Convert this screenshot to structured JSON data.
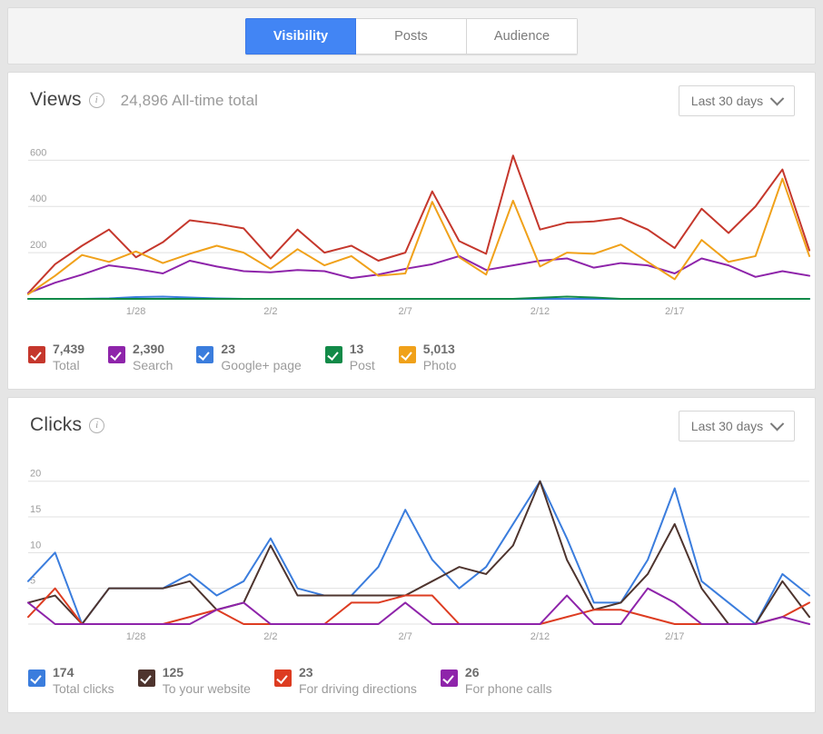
{
  "tabs": [
    {
      "label": "Visibility",
      "active": true
    },
    {
      "label": "Posts",
      "active": false
    },
    {
      "label": "Audience",
      "active": false
    }
  ],
  "views_card": {
    "title": "Views",
    "info_icon": "info-icon",
    "subtitle": "24,896 All-time total",
    "range_label": "Last 30 days",
    "legend": [
      {
        "value": "7,439",
        "label": "Total",
        "color": "#c5372c"
      },
      {
        "value": "2,390",
        "label": "Search",
        "color": "#8e24aa"
      },
      {
        "value": "23",
        "label": "Google+ page",
        "color": "#3b7ddd"
      },
      {
        "value": "13",
        "label": "Post",
        "color": "#128a48"
      },
      {
        "value": "5,013",
        "label": "Photo",
        "color": "#f0a11a"
      }
    ]
  },
  "clicks_card": {
    "title": "Clicks",
    "info_icon": "info-icon",
    "range_label": "Last 30 days",
    "legend": [
      {
        "value": "174",
        "label": "Total clicks",
        "color": "#3b7ddd"
      },
      {
        "value": "125",
        "label": "To your website",
        "color": "#4e342e"
      },
      {
        "value": "23",
        "label": "For driving directions",
        "color": "#dd3c21"
      },
      {
        "value": "26",
        "label": "For phone calls",
        "color": "#8e24aa"
      }
    ]
  },
  "chart_data": [
    {
      "type": "line",
      "id": "views",
      "title": "Views",
      "xlabel": "",
      "ylabel": "",
      "ylim": [
        0,
        680
      ],
      "yticks": [
        200,
        400,
        600
      ],
      "grid": true,
      "legend_position": "bottom",
      "x": [
        "1/24",
        "1/25",
        "1/26",
        "1/27",
        "1/28",
        "1/29",
        "1/30",
        "1/31",
        "2/1",
        "2/2",
        "2/3",
        "2/4",
        "2/5",
        "2/6",
        "2/7",
        "2/8",
        "2/9",
        "2/10",
        "2/11",
        "2/12",
        "2/13",
        "2/14",
        "2/15",
        "2/16",
        "2/17",
        "2/18",
        "2/19",
        "2/20",
        "2/21",
        "2/22"
      ],
      "xticks": [
        "1/28",
        "2/2",
        "2/7",
        "2/12",
        "2/17"
      ],
      "series": [
        {
          "name": "Total",
          "color": "#c5372c",
          "values": [
            25,
            150,
            230,
            300,
            180,
            245,
            340,
            325,
            305,
            175,
            300,
            200,
            230,
            165,
            200,
            465,
            250,
            195,
            620,
            300,
            330,
            335,
            350,
            300,
            220,
            390,
            285,
            400,
            560,
            210
          ]
        },
        {
          "name": "Search",
          "color": "#8e24aa",
          "values": [
            25,
            70,
            105,
            145,
            130,
            110,
            165,
            140,
            120,
            115,
            125,
            120,
            90,
            105,
            130,
            150,
            185,
            125,
            145,
            165,
            175,
            135,
            155,
            145,
            110,
            175,
            145,
            95,
            120,
            100
          ]
        },
        {
          "name": "Google+ page",
          "color": "#3b7ddd",
          "values": [
            0,
            0,
            0,
            2,
            8,
            10,
            6,
            2,
            0,
            0,
            0,
            0,
            0,
            0,
            0,
            0,
            0,
            0,
            0,
            0,
            0,
            0,
            0,
            0,
            0,
            0,
            0,
            0,
            0,
            0
          ]
        },
        {
          "name": "Post",
          "color": "#128a48",
          "values": [
            0,
            0,
            0,
            0,
            0,
            0,
            0,
            0,
            0,
            0,
            0,
            0,
            0,
            0,
            0,
            0,
            0,
            0,
            0,
            5,
            10,
            6,
            0,
            0,
            0,
            0,
            0,
            0,
            0,
            0
          ]
        },
        {
          "name": "Photo",
          "color": "#f0a11a",
          "values": [
            20,
            100,
            190,
            160,
            205,
            155,
            195,
            230,
            200,
            130,
            215,
            145,
            185,
            100,
            110,
            420,
            180,
            105,
            425,
            140,
            200,
            195,
            235,
            160,
            85,
            255,
            160,
            185,
            520,
            185
          ]
        }
      ]
    },
    {
      "type": "line",
      "id": "clicks",
      "title": "Clicks",
      "xlabel": "",
      "ylabel": "",
      "ylim": [
        0,
        22
      ],
      "yticks": [
        5,
        10,
        15,
        20
      ],
      "grid": true,
      "legend_position": "bottom",
      "x": [
        "1/24",
        "1/25",
        "1/26",
        "1/27",
        "1/28",
        "1/29",
        "1/30",
        "1/31",
        "2/1",
        "2/2",
        "2/3",
        "2/4",
        "2/5",
        "2/6",
        "2/7",
        "2/8",
        "2/9",
        "2/10",
        "2/11",
        "2/12",
        "2/13",
        "2/14",
        "2/15",
        "2/16",
        "2/17",
        "2/18",
        "2/19",
        "2/20",
        "2/21",
        "2/22"
      ],
      "xticks": [
        "1/28",
        "2/2",
        "2/7",
        "2/12",
        "2/17"
      ],
      "series": [
        {
          "name": "Total clicks",
          "color": "#3b7ddd",
          "values": [
            6,
            10,
            0,
            5,
            5,
            5,
            7,
            4,
            6,
            12,
            5,
            4,
            4,
            8,
            16,
            9,
            5,
            8,
            14,
            20,
            12,
            3,
            3,
            9,
            19,
            6,
            3,
            0,
            7,
            4
          ]
        },
        {
          "name": "To your website",
          "color": "#4e342e",
          "values": [
            3,
            4,
            0,
            5,
            5,
            5,
            6,
            2,
            3,
            11,
            4,
            4,
            4,
            4,
            4,
            6,
            8,
            7,
            11,
            20,
            9,
            2,
            3,
            7,
            14,
            5,
            0,
            0,
            6,
            1
          ]
        },
        {
          "name": "For driving directions",
          "color": "#dd3c21",
          "values": [
            1,
            5,
            0,
            0,
            0,
            0,
            1,
            2,
            0,
            0,
            0,
            0,
            3,
            3,
            4,
            4,
            0,
            0,
            0,
            0,
            1,
            2,
            2,
            1,
            0,
            0,
            0,
            0,
            1,
            3
          ]
        },
        {
          "name": "For phone calls",
          "color": "#8e24aa",
          "values": [
            3,
            0,
            0,
            0,
            0,
            0,
            0,
            2,
            3,
            0,
            0,
            0,
            0,
            0,
            3,
            0,
            0,
            0,
            0,
            0,
            4,
            0,
            0,
            5,
            3,
            0,
            0,
            0,
            1,
            0
          ]
        }
      ]
    }
  ]
}
